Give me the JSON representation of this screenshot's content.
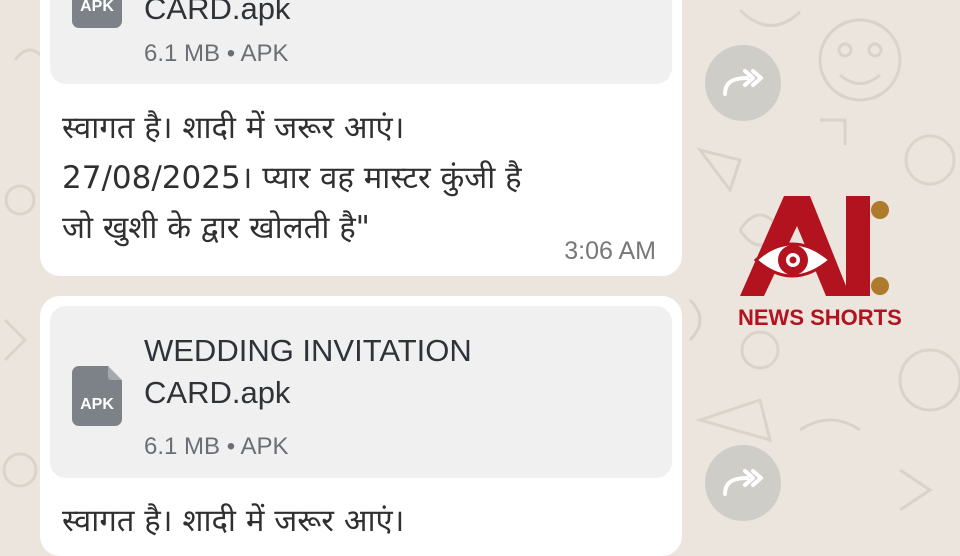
{
  "messages": [
    {
      "file": {
        "icon_label": "APK",
        "name_lines": [
          "CARD.apk"
        ],
        "meta": "6.1 MB • APK"
      },
      "text_lines": [
        "स्वागत है। शादी में जरूर आएं।",
        "27/08/2025। प्यार वह मास्टर कुंजी है",
        "जो खुशी के द्वार खोलती है\""
      ],
      "time": "3:06 AM"
    },
    {
      "file": {
        "icon_label": "APK",
        "name_lines": [
          "WEDDING INVITATION",
          "CARD.apk"
        ],
        "meta": "6.1 MB • APK"
      },
      "text_lines": [
        "स्वागत है। शादी में जरूर आएं।"
      ]
    }
  ],
  "forward_icon": "forward-arrow-icon",
  "watermark": {
    "logo_letters": "AI",
    "text": "NEWS SHORTS",
    "color": "#b3121f"
  }
}
